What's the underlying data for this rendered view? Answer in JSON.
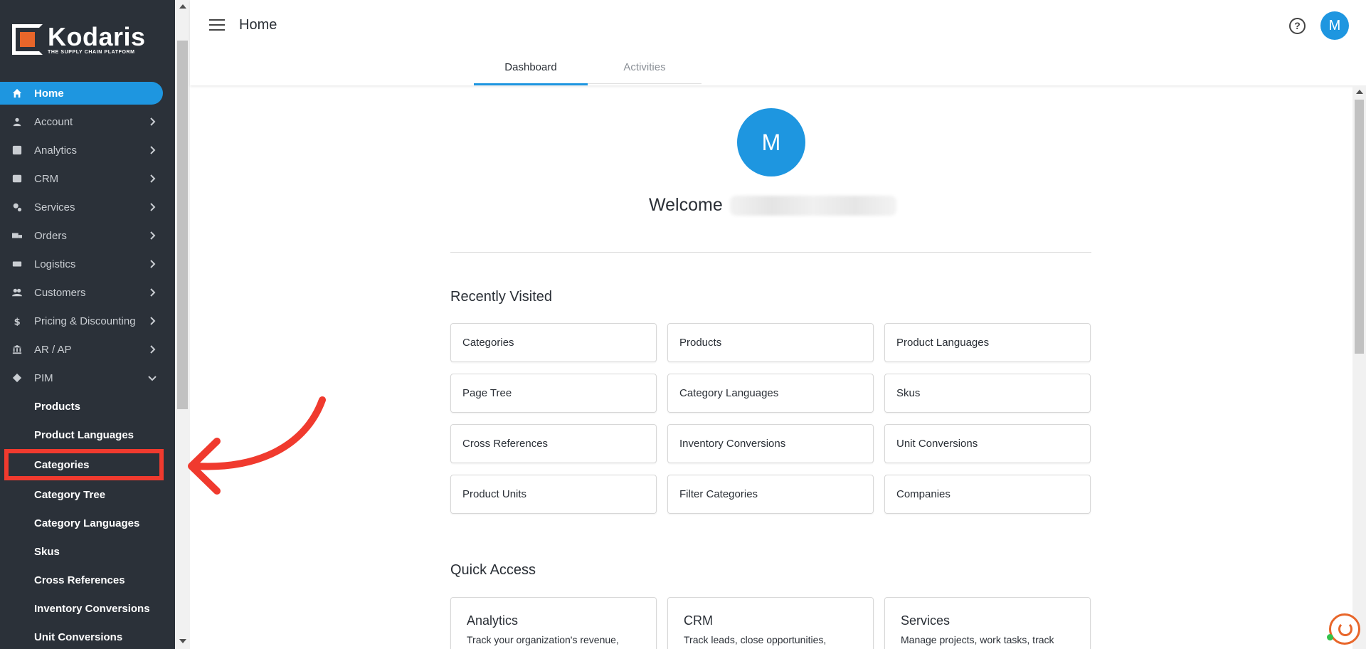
{
  "app": {
    "logo_brand": "Kodaris",
    "logo_tagline": "THE SUPPLY CHAIN PLATFORM"
  },
  "sidebar": {
    "items": [
      {
        "label": "Home",
        "icon": "home-icon"
      },
      {
        "label": "Account",
        "icon": "person-icon"
      },
      {
        "label": "Analytics",
        "icon": "analytics-icon"
      },
      {
        "label": "CRM",
        "icon": "contact-card-icon"
      },
      {
        "label": "Services",
        "icon": "gears-icon"
      },
      {
        "label": "Orders",
        "icon": "truck-icon"
      },
      {
        "label": "Logistics",
        "icon": "delivery-icon"
      },
      {
        "label": "Customers",
        "icon": "people-icon"
      },
      {
        "label": "Pricing & Discounting",
        "icon": "dollar-icon"
      },
      {
        "label": "AR / AP",
        "icon": "bank-icon"
      },
      {
        "label": "PIM",
        "icon": "tag-icon"
      }
    ],
    "pim_subitems": [
      "Products",
      "Product Languages",
      "Categories",
      "Category Tree",
      "Category Languages",
      "Skus",
      "Cross References",
      "Inventory Conversions",
      "Unit Conversions"
    ]
  },
  "header": {
    "title": "Home",
    "help_label": "?",
    "avatar_initial": "M",
    "tabs": [
      "Dashboard",
      "Activities"
    ]
  },
  "main": {
    "avatar_initial": "M",
    "welcome_label": "Welcome",
    "recently_visited_title": "Recently Visited",
    "recently_visited": [
      "Categories",
      "Products",
      "Product Languages",
      "Page Tree",
      "Category Languages",
      "Skus",
      "Cross References",
      "Inventory Conversions",
      "Unit Conversions",
      "Product Units",
      "Filter Categories",
      "Companies"
    ],
    "quick_access_title": "Quick Access",
    "quick_access": [
      {
        "title": "Analytics",
        "desc": "Track your organization's revenue,"
      },
      {
        "title": "CRM",
        "desc": "Track leads, close opportunities,"
      },
      {
        "title": "Services",
        "desc": "Manage projects, work tasks, track"
      }
    ]
  },
  "colors": {
    "accent": "#1e96e0",
    "sidebar_bg": "#2b3139",
    "annotation": "#f03a2e"
  }
}
